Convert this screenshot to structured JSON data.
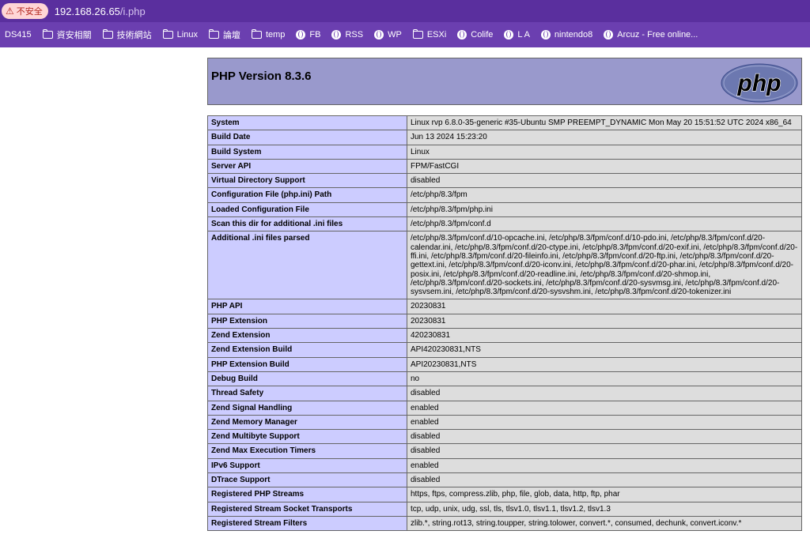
{
  "browser": {
    "insecure_label": "不安全",
    "url_host": "192.168.26.65",
    "url_path": "/i.php"
  },
  "bookmarks": [
    {
      "label": "DS415",
      "icon": "none"
    },
    {
      "label": "資安相關",
      "icon": "folder-icon"
    },
    {
      "label": "技術網站",
      "icon": "folder-icon"
    },
    {
      "label": "Linux",
      "icon": "folder-icon"
    },
    {
      "label": "論壇",
      "icon": "folder-icon"
    },
    {
      "label": "temp",
      "icon": "folder-icon"
    },
    {
      "label": "FB",
      "icon": "globe-icon"
    },
    {
      "label": "RSS",
      "icon": "globe-icon"
    },
    {
      "label": "WP",
      "icon": "globe-icon"
    },
    {
      "label": "ESXi",
      "icon": "folder-icon"
    },
    {
      "label": "Colife",
      "icon": "globe-icon"
    },
    {
      "label": "L A",
      "icon": "globe-icon"
    },
    {
      "label": "nintendo8",
      "icon": "globe-icon"
    },
    {
      "label": "Arcuz - Free online...",
      "icon": "globe-icon"
    }
  ],
  "phpinfo": {
    "title": "PHP Version 8.3.6",
    "logo_text": "php",
    "header_color": "#9999cc",
    "rows": [
      {
        "key": "System",
        "value": "Linux rvp 6.8.0-35-generic #35-Ubuntu SMP PREEMPT_DYNAMIC Mon May 20 15:51:52 UTC 2024 x86_64"
      },
      {
        "key": "Build Date",
        "value": "Jun 13 2024 15:23:20"
      },
      {
        "key": "Build System",
        "value": "Linux"
      },
      {
        "key": "Server API",
        "value": "FPM/FastCGI"
      },
      {
        "key": "Virtual Directory Support",
        "value": "disabled"
      },
      {
        "key": "Configuration File (php.ini) Path",
        "value": "/etc/php/8.3/fpm"
      },
      {
        "key": "Loaded Configuration File",
        "value": "/etc/php/8.3/fpm/php.ini"
      },
      {
        "key": "Scan this dir for additional .ini files",
        "value": "/etc/php/8.3/fpm/conf.d"
      },
      {
        "key": "Additional .ini files parsed",
        "value": "/etc/php/8.3/fpm/conf.d/10-opcache.ini, /etc/php/8.3/fpm/conf.d/10-pdo.ini, /etc/php/8.3/fpm/conf.d/20-calendar.ini, /etc/php/8.3/fpm/conf.d/20-ctype.ini, /etc/php/8.3/fpm/conf.d/20-exif.ini, /etc/php/8.3/fpm/conf.d/20-ffi.ini, /etc/php/8.3/fpm/conf.d/20-fileinfo.ini, /etc/php/8.3/fpm/conf.d/20-ftp.ini, /etc/php/8.3/fpm/conf.d/20-gettext.ini, /etc/php/8.3/fpm/conf.d/20-iconv.ini, /etc/php/8.3/fpm/conf.d/20-phar.ini, /etc/php/8.3/fpm/conf.d/20-posix.ini, /etc/php/8.3/fpm/conf.d/20-readline.ini, /etc/php/8.3/fpm/conf.d/20-shmop.ini, /etc/php/8.3/fpm/conf.d/20-sockets.ini, /etc/php/8.3/fpm/conf.d/20-sysvmsg.ini, /etc/php/8.3/fpm/conf.d/20-sysvsem.ini, /etc/php/8.3/fpm/conf.d/20-sysvshm.ini, /etc/php/8.3/fpm/conf.d/20-tokenizer.ini"
      },
      {
        "key": "PHP API",
        "value": "20230831"
      },
      {
        "key": "PHP Extension",
        "value": "20230831"
      },
      {
        "key": "Zend Extension",
        "value": "420230831"
      },
      {
        "key": "Zend Extension Build",
        "value": "API420230831,NTS"
      },
      {
        "key": "PHP Extension Build",
        "value": "API20230831,NTS"
      },
      {
        "key": "Debug Build",
        "value": "no"
      },
      {
        "key": "Thread Safety",
        "value": "disabled"
      },
      {
        "key": "Zend Signal Handling",
        "value": "enabled"
      },
      {
        "key": "Zend Memory Manager",
        "value": "enabled"
      },
      {
        "key": "Zend Multibyte Support",
        "value": "disabled"
      },
      {
        "key": "Zend Max Execution Timers",
        "value": "disabled"
      },
      {
        "key": "IPv6 Support",
        "value": "enabled"
      },
      {
        "key": "DTrace Support",
        "value": "disabled"
      },
      {
        "key": "Registered PHP Streams",
        "value": "https, ftps, compress.zlib, php, file, glob, data, http, ftp, phar"
      },
      {
        "key": "Registered Stream Socket Transports",
        "value": "tcp, udp, unix, udg, ssl, tls, tlsv1.0, tlsv1.1, tlsv1.2, tlsv1.3"
      },
      {
        "key": "Registered Stream Filters",
        "value": "zlib.*, string.rot13, string.toupper, string.tolower, convert.*, consumed, dechunk, convert.iconv.*"
      }
    ]
  }
}
